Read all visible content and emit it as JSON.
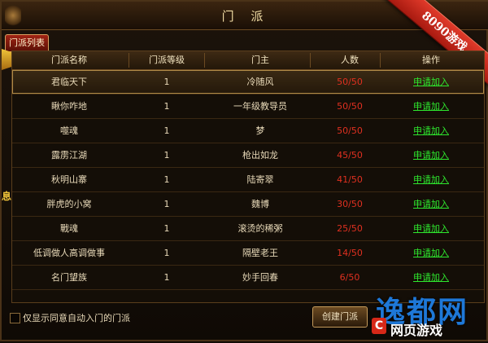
{
  "window": {
    "title": "门 派",
    "tab_label": "门派列表",
    "ribbon_text": "8090游戏",
    "side_text": "息!"
  },
  "table": {
    "headers": [
      "门派名称",
      "门派等级",
      "门主",
      "人数",
      "操作"
    ],
    "rows": [
      {
        "name": "君临天下",
        "level": "1",
        "master": "冷随风",
        "count": "50/50",
        "action": "申请加入"
      },
      {
        "name": "瞅你咋地",
        "level": "1",
        "master": "一年级教导员",
        "count": "50/50",
        "action": "申请加入"
      },
      {
        "name": "噬魂",
        "level": "1",
        "master": "梦",
        "count": "50/50",
        "action": "申请加入"
      },
      {
        "name": "露雳江湖",
        "level": "1",
        "master": "枪出如龙",
        "count": "45/50",
        "action": "申请加入"
      },
      {
        "name": "秋明山寨",
        "level": "1",
        "master": "陆寄翠",
        "count": "41/50",
        "action": "申请加入"
      },
      {
        "name": "胖虎的小窝",
        "level": "1",
        "master": "魏博",
        "count": "30/50",
        "action": "申请加入"
      },
      {
        "name": "戰魂",
        "level": "1",
        "master": "滚烫的稀粥",
        "count": "25/50",
        "action": "申请加入"
      },
      {
        "name": "低调做人高调做事",
        "level": "1",
        "master": "隔壁老王",
        "count": "14/50",
        "action": "申请加入"
      },
      {
        "name": "名门望族",
        "level": "1",
        "master": "妙手回春",
        "count": "6/50",
        "action": "申请加入"
      }
    ]
  },
  "footer": {
    "checkbox_label": "仅显示同意自动入门的门派",
    "create_button": "创建门派"
  },
  "watermark": {
    "big": "逸都网",
    "small": "网页游戏",
    "logo": "C"
  },
  "colors": {
    "count_red": "#e03020",
    "join_green": "#2ee82e",
    "ribbon_red": "#c82a1a"
  }
}
